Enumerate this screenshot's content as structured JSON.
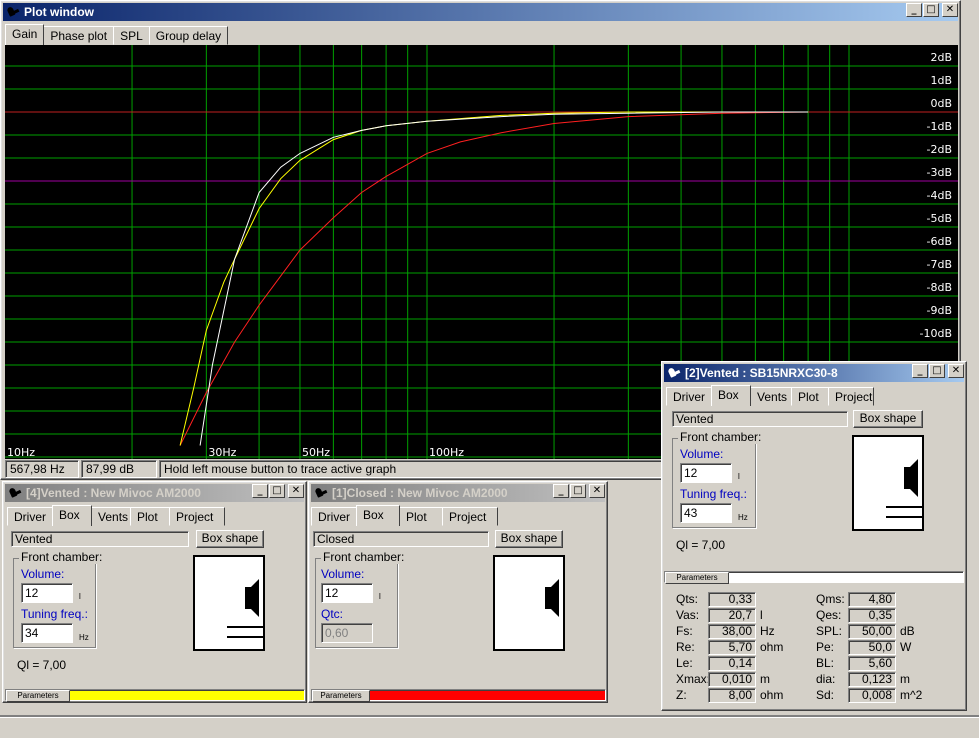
{
  "plot_window": {
    "title": "Plot window",
    "tabs": [
      "Gain",
      "Phase plot",
      "SPL",
      "Group delay"
    ],
    "status": [
      "567,98 Hz",
      "87,99 dB",
      "Hold left mouse button to trace active graph"
    ]
  },
  "chart_data": {
    "type": "line",
    "x_scale": "log",
    "xlim": [
      10,
      1000
    ],
    "ylim": [
      -15,
      3
    ],
    "x_tick_labels": [
      {
        "v": 10,
        "t": "10Hz"
      },
      {
        "v": 30,
        "t": "30Hz"
      },
      {
        "v": 50,
        "t": "50Hz"
      },
      {
        "v": 100,
        "t": "100Hz"
      }
    ],
    "y_tick_labels": [
      "2dB",
      "1dB",
      "0dB",
      "-1dB",
      "-2dB",
      "-3dB",
      "-4dB",
      "-5dB",
      "-6dB",
      "-7dB",
      "-8dB",
      "-9dB",
      "-10dB"
    ],
    "y_tick_values": [
      2,
      1,
      0,
      -1,
      -2,
      -3,
      -4,
      -5,
      -6,
      -7,
      -8,
      -9,
      -10
    ],
    "grid": true,
    "series": [
      {
        "color": "#ffffff",
        "x": [
          29,
          31,
          35,
          40,
          45,
          50,
          60,
          70,
          80,
          100,
          150,
          200,
          300,
          500,
          800
        ],
        "y": [
          -14.5,
          -11,
          -6.4,
          -3.5,
          -2.4,
          -1.8,
          -1.1,
          -0.8,
          -0.6,
          -0.4,
          -0.2,
          -0.1,
          -0.05,
          0,
          0
        ]
      },
      {
        "color": "#ffff00",
        "x": [
          26,
          28,
          30,
          33,
          35,
          40,
          45,
          50,
          60,
          70,
          80,
          100,
          150,
          200,
          300,
          500,
          800
        ],
        "y": [
          -14.5,
          -12,
          -9.5,
          -7.4,
          -6.4,
          -4.2,
          -2.9,
          -2.1,
          -1.2,
          -0.8,
          -0.6,
          -0.4,
          -0.15,
          -0.05,
          0,
          0,
          0
        ]
      },
      {
        "color": "#ff2020",
        "x": [
          26,
          30,
          35,
          40,
          50,
          60,
          70,
          80,
          100,
          120,
          150,
          200,
          300,
          500,
          800
        ],
        "y": [
          -14.5,
          -12.2,
          -10,
          -8.4,
          -6,
          -4.6,
          -3.5,
          -2.8,
          -1.8,
          -1.3,
          -0.9,
          -0.5,
          -0.2,
          -0.05,
          0
        ]
      }
    ]
  },
  "win4": {
    "title": "[4]Vented : New Mivoc AM2000",
    "tabs": [
      "Driver",
      "Box",
      "Vents",
      "Plot",
      "Project"
    ],
    "type_value": "Vented",
    "box_shape_label": "Box shape",
    "front_chamber": "Front chamber:",
    "volume_label": "Volume:",
    "volume": "12",
    "volume_unit": "l",
    "tuning_label": "Tuning freq.:",
    "tuning": "34",
    "tuning_unit": "Hz",
    "ql": "Ql = 7,00",
    "params_label": "Parameters",
    "color": "#ffff00"
  },
  "win1": {
    "title": "[1]Closed : New Mivoc AM2000",
    "tabs": [
      "Driver",
      "Box",
      "Plot",
      "Project"
    ],
    "type_value": "Closed",
    "box_shape_label": "Box shape",
    "front_chamber": "Front chamber:",
    "volume_label": "Volume:",
    "volume": "12",
    "volume_unit": "l",
    "qtc_label": "Qtc:",
    "qtc": "0,60",
    "params_label": "Parameters",
    "color": "#ff0000"
  },
  "win2": {
    "title": "[2]Vented : SB15NRXC30-8",
    "tabs": [
      "Driver",
      "Box",
      "Vents",
      "Plot",
      "Project"
    ],
    "type_value": "Vented",
    "box_shape_label": "Box shape",
    "front_chamber": "Front chamber:",
    "volume_label": "Volume:",
    "volume": "12",
    "volume_unit": "l",
    "tuning_label": "Tuning freq.:",
    "tuning": "43",
    "tuning_unit": "Hz",
    "ql": "Ql = 7,00",
    "params_label": "Parameters",
    "color": "#ffffff",
    "params": [
      {
        "l": "Qts:",
        "v": "0,33",
        "u": "",
        "l2": "Qms:",
        "v2": "4,80",
        "u2": ""
      },
      {
        "l": "Vas:",
        "v": "20,7",
        "u": "l",
        "l2": "Qes:",
        "v2": "0,35",
        "u2": ""
      },
      {
        "l": "Fs:",
        "v": "38,00",
        "u": "Hz",
        "l2": "SPL:",
        "v2": "50,00",
        "u2": "dB"
      },
      {
        "l": "Re:",
        "v": "5,70",
        "u": "ohm",
        "l2": "Pe:",
        "v2": "50,0",
        "u2": "W"
      },
      {
        "l": "Le:",
        "v": "0,14",
        "u": "",
        "l2": "BL:",
        "v2": "5,60",
        "u2": ""
      },
      {
        "l": "Xmax:",
        "v": "0,010",
        "u": "m",
        "l2": "dia:",
        "v2": "0,123",
        "u2": "m"
      },
      {
        "l": "Z:",
        "v": "8,00",
        "u": "ohm",
        "l2": "Sd:",
        "v2": "0,008",
        "u2": "m^2"
      }
    ]
  },
  "colors": {
    "title_active": "#0a246a",
    "title_inactive": "#808080",
    "face": "#d4d0c8",
    "grid": "#00a000"
  }
}
